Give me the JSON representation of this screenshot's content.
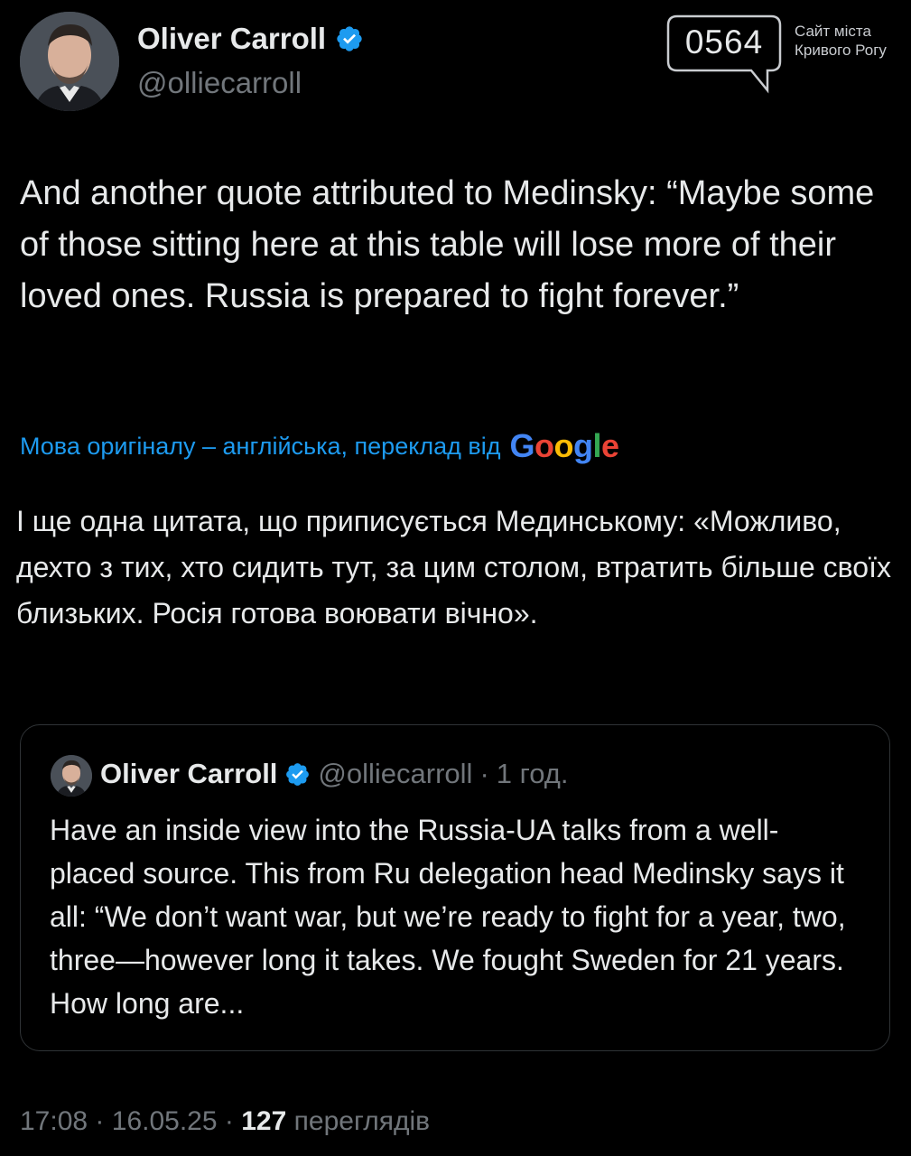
{
  "author": {
    "name": "Oliver Carroll",
    "handle": "@olliecarroll"
  },
  "site_logo": {
    "number": "0564",
    "caption_line1": "Сайт міста",
    "caption_line2": "Кривого Рогу"
  },
  "tweet": {
    "text": "And another quote attributed to Medinsky: “Maybe some of those sitting here at this table will lose more of their loved ones. Russia is prepared to fight forever.”"
  },
  "translation": {
    "notice": "Мова оригіналу – англійська, переклад від",
    "provider": "Google",
    "text": "І ще одна цитата, що приписується Мединському: «Можливо, дехто з тих, хто сидить тут, за цим столом, втратить більше своїх близьких. Росія готова воювати вічно»."
  },
  "quoted_tweet": {
    "name": "Oliver Carroll",
    "handle": "@olliecarroll",
    "separator": "·",
    "time": "1 год.",
    "text": "Have an inside view into the Russia-UA talks from a well-placed source. This from Ru delegation head Medinsky says it all: “We don’t want war, but we’re ready to fight for a year, two, three—however long it takes. We fought Sweden for 21 years. How long are..."
  },
  "meta": {
    "time": "17:08",
    "separator": "·",
    "date": "16.05.25",
    "views_count": "127",
    "views_label": "переглядів"
  },
  "colors": {
    "background": "#000000",
    "text": "#e7e9ea",
    "secondary": "#71767b",
    "link": "#1d9bf0",
    "verified": "#1d9bf0"
  }
}
